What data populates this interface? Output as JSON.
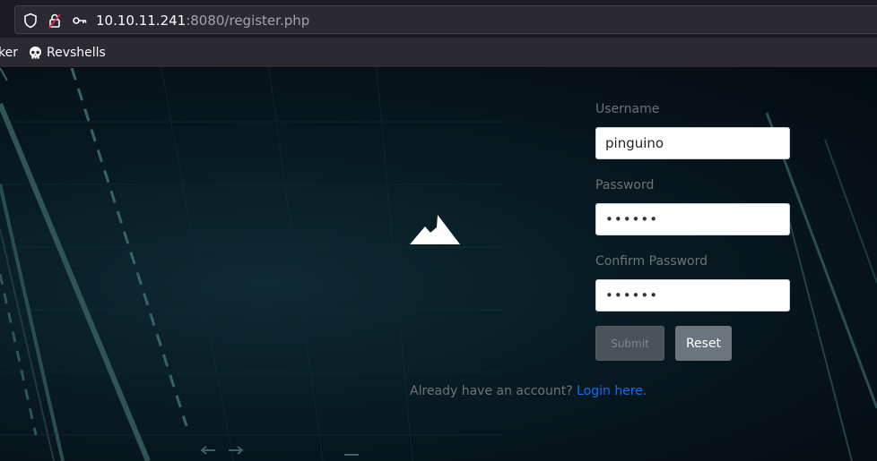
{
  "browser": {
    "url_host": "10.10.11.241",
    "url_rest": ":8080/register.php",
    "bookmarks": [
      {
        "label": "ker"
      },
      {
        "label": "Revshells"
      }
    ]
  },
  "form": {
    "username_label": "Username",
    "username_value": "pinguino",
    "password_label": "Password",
    "password_value": "••••••",
    "confirm_label": "Confirm Password",
    "confirm_value": "••••••",
    "submit_label": "Submit",
    "reset_label": "Reset",
    "login_prompt": "Already have an account?",
    "login_link": "Login here."
  },
  "colors": {
    "link": "#0d6efd",
    "reset_bg": "#6c757d",
    "submit_bg": "#4a5359"
  }
}
